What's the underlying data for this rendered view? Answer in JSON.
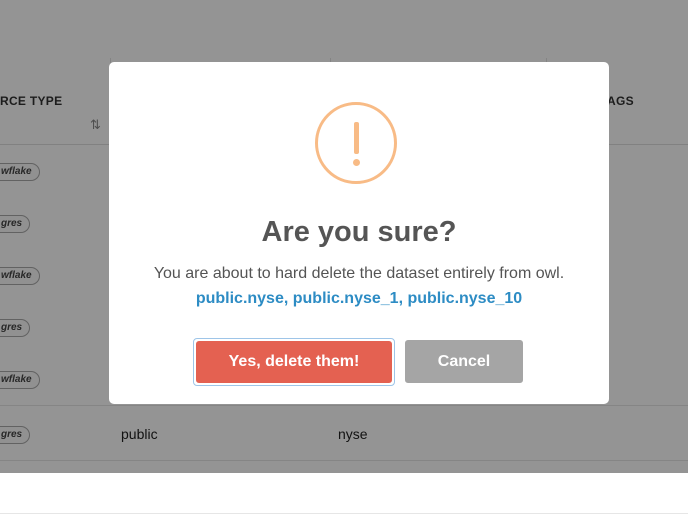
{
  "table": {
    "headers": {
      "source_type": "RCE TYPE",
      "tags": "AGS"
    },
    "rows": [
      {
        "source": "wflake",
        "schema": "",
        "table": ""
      },
      {
        "source": "gres",
        "schema": "",
        "table": ""
      },
      {
        "source": "wflake",
        "schema": "",
        "table": ""
      },
      {
        "source": "gres",
        "schema": "",
        "table": ""
      },
      {
        "source": "wflake",
        "schema": "",
        "table": ""
      },
      {
        "source": "gres",
        "schema": "public",
        "table": "nyse"
      }
    ]
  },
  "dialog": {
    "icon": "warning-icon",
    "title": "Are you sure?",
    "message": "You are about to hard delete the dataset entirely from owl.",
    "datasets": "public.nyse, public.nyse_1, public.nyse_10",
    "confirm_label": "Yes, delete them!",
    "cancel_label": "Cancel"
  },
  "colors": {
    "warning": "#f8bb86",
    "confirm": "#e46151",
    "cancel": "#a5a5a5",
    "dataset_link": "#2d8cc4"
  }
}
